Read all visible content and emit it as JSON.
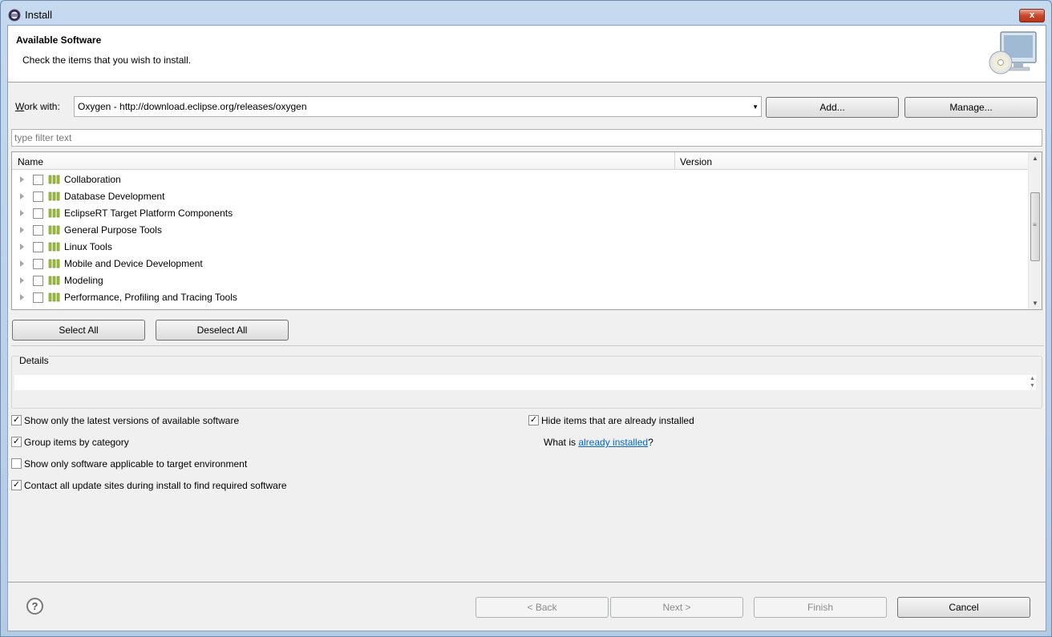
{
  "window": {
    "title": "Install",
    "close_label": "x"
  },
  "banner": {
    "title": "Available Software",
    "description": "Check the items that you wish to install."
  },
  "work_with": {
    "label_mnemonic": "W",
    "label_rest": "ork with:",
    "value": "Oxygen - http://download.eclipse.org/releases/oxygen",
    "add_label": "Add...",
    "manage_label": "Manage..."
  },
  "filter": {
    "placeholder": "type filter text"
  },
  "tree": {
    "columns": [
      "Name",
      "Version"
    ],
    "items": [
      {
        "label": "Collaboration",
        "checked": false
      },
      {
        "label": "Database Development",
        "checked": false
      },
      {
        "label": "EclipseRT Target Platform Components",
        "checked": false
      },
      {
        "label": "General Purpose Tools",
        "checked": false
      },
      {
        "label": "Linux Tools",
        "checked": false
      },
      {
        "label": "Mobile and Device Development",
        "checked": false
      },
      {
        "label": "Modeling",
        "checked": false
      },
      {
        "label": "Performance, Profiling and Tracing Tools",
        "checked": false
      }
    ]
  },
  "selection_buttons": {
    "select_all": "Select All",
    "deselect_all": "Deselect All"
  },
  "details": {
    "label": "Details"
  },
  "options": {
    "latest_versions": {
      "label": "Show only the latest versions of available software",
      "checked": true
    },
    "group_by_category": {
      "label": "Group items by category",
      "checked": true
    },
    "applicable_target": {
      "label": "Show only software applicable to target environment",
      "checked": false
    },
    "contact_update_sites": {
      "label": "Contact all update sites during install to find required software",
      "checked": true
    },
    "hide_installed": {
      "label": "Hide items that are already installed",
      "checked": true
    },
    "what_is_prefix": "What is ",
    "already_installed_link": "already installed",
    "what_is_suffix": "?"
  },
  "footer": {
    "back": "< Back",
    "next": "Next >",
    "finish": "Finish",
    "cancel": "Cancel",
    "help": "?"
  },
  "colors": {
    "link": "#0066cc",
    "window_frame": "#b9d1ea",
    "dialog_bg": "#f0f0f0"
  }
}
